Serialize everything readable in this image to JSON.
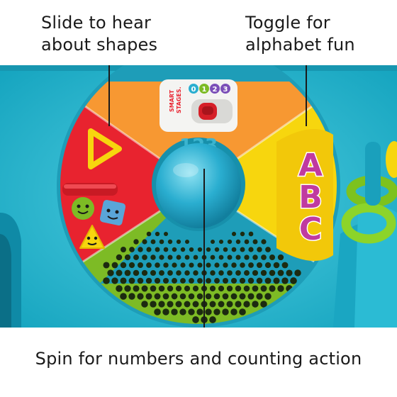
{
  "callouts": {
    "shapes": [
      "Slide to hear",
      "about shapes"
    ],
    "alphabet": [
      "Toggle for",
      "alphabet fun"
    ],
    "spin": "Spin for numbers and counting action"
  },
  "toy": {
    "badge_line1": "SMART",
    "badge_line2": "STAGES.",
    "stage_digits": [
      "0",
      "1",
      "2",
      "3"
    ],
    "letters": [
      "A",
      "B",
      "C"
    ],
    "ball_text": "123"
  },
  "colors": {
    "red_panel": "#e8232f",
    "orange_panel": "#f7932b",
    "yellow_panel": "#f7d60e",
    "green_panel": "#7dbb25",
    "teal_body": "#23b6cf",
    "ball": "#2aaed0",
    "letters": "#c03aa0"
  }
}
